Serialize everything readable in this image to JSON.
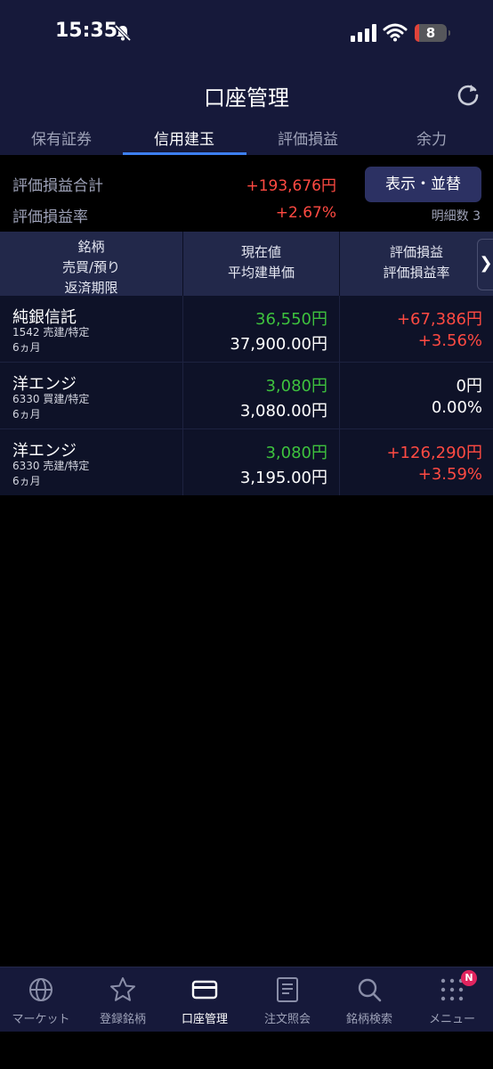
{
  "status": {
    "time": "15:35",
    "battery": "8"
  },
  "header": {
    "title": "口座管理"
  },
  "tabs": [
    {
      "label": "保有証券"
    },
    {
      "label": "信用建玉"
    },
    {
      "label": "評価損益"
    },
    {
      "label": "余力"
    }
  ],
  "summary": {
    "total_label": "評価損益合計",
    "total_value": "+193,676円",
    "rate_label": "評価損益率",
    "rate_value": "+2.67%",
    "display_button": "表示・並替",
    "count_text": "明細数 3"
  },
  "table_headers": {
    "col1": [
      "銘柄",
      "売買/預り",
      "返済期限"
    ],
    "col2": [
      "現在値",
      "平均建単価"
    ],
    "col3": [
      "評価損益",
      "評価損益率"
    ]
  },
  "rows": [
    {
      "name": "純銀信託",
      "sub1": "1542 売建/特定",
      "sub2": "6ヵ月",
      "price": "36,550円",
      "avg": "37,900.00円",
      "pl": "+67,386円",
      "rate": "+3.56%",
      "pl_color": "red"
    },
    {
      "name": "洋エンジ",
      "sub1": "6330 買建/特定",
      "sub2": "6ヵ月",
      "price": "3,080円",
      "avg": "3,080.00円",
      "pl": "0円",
      "rate": "0.00%",
      "pl_color": "white"
    },
    {
      "name": "洋エンジ",
      "sub1": "6330 売建/特定",
      "sub2": "6ヵ月",
      "price": "3,080円",
      "avg": "3,195.00円",
      "pl": "+126,290円",
      "rate": "+3.59%",
      "pl_color": "red"
    }
  ],
  "tabbar": [
    {
      "label": "マーケット",
      "icon": "globe-icon"
    },
    {
      "label": "登録銘柄",
      "icon": "star-icon"
    },
    {
      "label": "口座管理",
      "icon": "card-icon"
    },
    {
      "label": "注文照会",
      "icon": "document-icon"
    },
    {
      "label": "銘柄検索",
      "icon": "search-icon"
    },
    {
      "label": "メニュー",
      "icon": "grid-icon"
    }
  ],
  "menu_badge": "N",
  "colors": {
    "accent": "#3d7ff0",
    "positive": "#ff4a42",
    "price": "#3ec23e",
    "header_bg": "#16193a"
  }
}
